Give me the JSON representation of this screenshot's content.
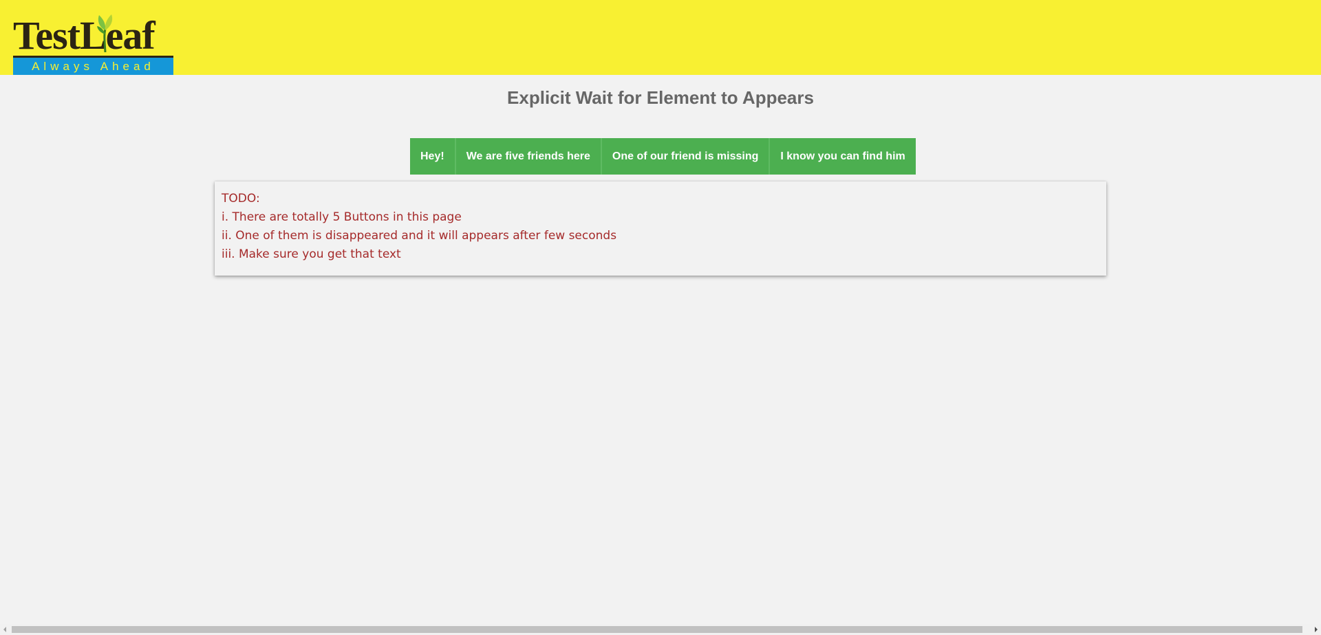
{
  "header": {
    "logo": {
      "word": "TestLeaf",
      "tagline": "Always Ahead"
    },
    "background_color": "#f8f032"
  },
  "page": {
    "title": "Explicit Wait for Element to Appears"
  },
  "buttons": [
    {
      "label": "Hey!"
    },
    {
      "label": "We are five friends here"
    },
    {
      "label": "One of our friend is missing"
    },
    {
      "label": "I know you can find him"
    }
  ],
  "button_color": "#4caf50",
  "todo": {
    "lines": [
      "TODO:",
      "i. There are totally 5 Buttons in this page",
      "ii. One of them is disappeared and it will appears after few seconds",
      "iii. Make sure you get that text"
    ],
    "text_color": "#a52a2a"
  }
}
